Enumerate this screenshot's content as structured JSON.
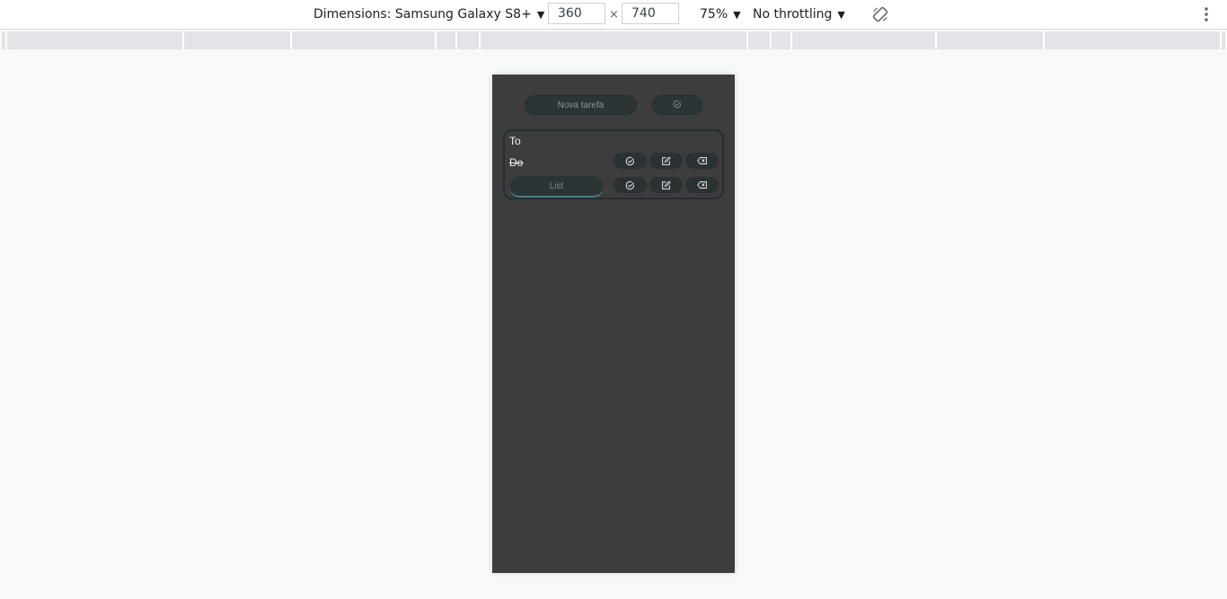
{
  "devtools": {
    "device_label": "Dimensions: Samsung Galaxy S8+",
    "caret": "▼",
    "width": "360",
    "height": "740",
    "times": "×",
    "zoom": "75%",
    "throttle": "No throttling",
    "rotate_icon": "rotate-icon",
    "more_icon": "more-vert-icon"
  },
  "app": {
    "new_task_placeholder": "Nova tarefa",
    "complete_all_icon": "check-circle-icon",
    "tasks": [
      {
        "text": "To",
        "done": false
      },
      {
        "text": "Do",
        "done": true
      }
    ],
    "list_input_value": "List",
    "row_actions": [
      "check-circle-icon",
      "edit-icon",
      "backspace-icon"
    ],
    "colors": {
      "screen_bg": "#3d3d3d",
      "pill_bg": "#2c3536",
      "accent": "#4a7f8c",
      "text": "#f2f2f2"
    }
  }
}
